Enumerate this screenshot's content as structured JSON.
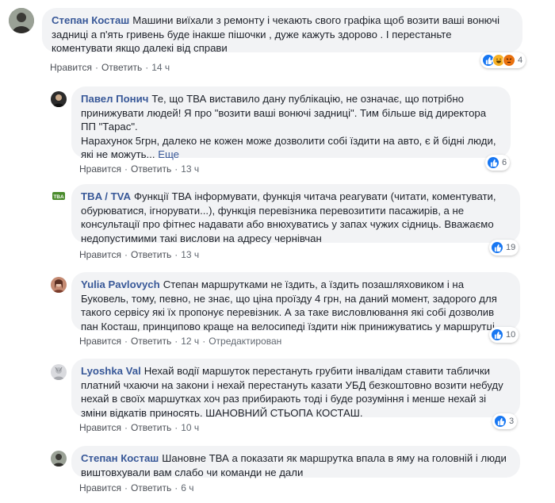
{
  "colors": {
    "link": "#385898",
    "bubble": "#f2f3f5",
    "like": "#1877f2"
  },
  "labels": {
    "like": "Нравится",
    "reply": "Ответить",
    "more": "Еще"
  },
  "comments": [
    {
      "author": "Степан Косташ",
      "text": "Машини виїхали з ремонту і чекають свого графіка щоб возити ваші вонючі задниці а п'ять гривень буде інакше пішочки , дуже кажуть здорово . І перестаньте коментувати якщо далекі від справи",
      "time": "14 ч",
      "reactions": [
        "like-icon",
        "haha-icon",
        "angry-icon"
      ],
      "count": "4"
    },
    {
      "author": "Павел Понич",
      "text1": "Те, що ТВА виставило дану публікацію, не означає, що потрібно принижувати людей! Я про \"возити ваші вонючі задниці\". Тим більше від директора ПП \"Тарас\".",
      "text2": "Нарахунок 5грн, далеко не кожен може дозволити собі їздити на авто, є й бідні люди, які не можуть...",
      "time": "13 ч",
      "count": "6"
    },
    {
      "author": "TBA / TVA",
      "avatar_text": "TBA",
      "text": "Функції ТВА інформувати, функція читача реагувати (читати, коментувати, обурюватися, ігнорувати...), функція перевізника перевозитити пасажирів, а не консультації про фітнес надавати або внюхуватись у запах чужих сідниць. Вважаємо недопустимими такі вислови на адресу чернівчан",
      "time": "13 ч",
      "count": "19"
    },
    {
      "author": "Yulia Pavlovych",
      "text": "Степан маршрутками не їздить, а їздить позашляховиком і на Буковель, тому, певно, не знає, що ціна проїзду 4 грн, на даний момент, задорого для такого сервісу які їх пропонує перевізник. А за таке висловлювання які собі дозволив пан Косташ, принципово краще на велосипеді їздити ніж принижуватись у маршрутці",
      "time": "12 ч",
      "edited": "Отредактирован",
      "count": "10"
    },
    {
      "author": "Lyoshka Val",
      "text": "Нехай водії маршуток перестануть грубити інвалідам ставити таблички платний чхаючи на закони і нехай перестануть казати УБД безкоштовно возити небуду нехай в своїх маршутках хоч раз прибирають тоді і буде розуміння і менше нехай зі зміни відкатів приносять. ШАНОВНИЙ СТЬОПА КОСТАШ.",
      "time": "10 ч",
      "count": "3"
    },
    {
      "author": "Степан Косташ",
      "text": "Шановне ТВА а показати як маршрутка впала в яму на головній і люди виштовхували вам слабо чи команди не дали",
      "time": "6 ч"
    }
  ]
}
